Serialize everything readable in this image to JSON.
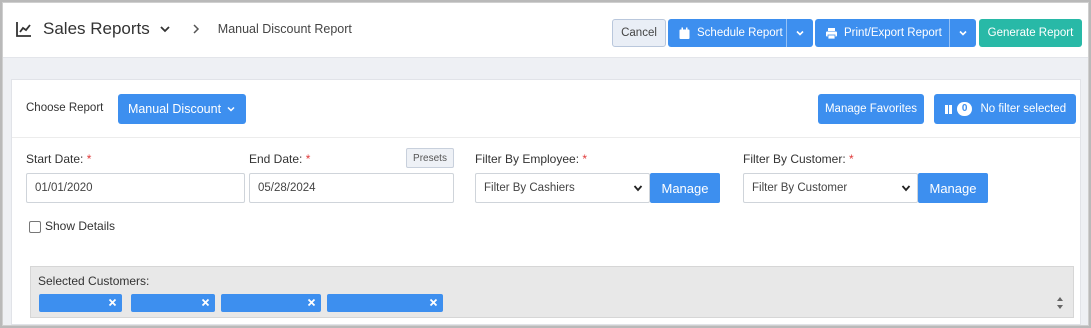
{
  "header": {
    "app_title": "Sales Reports",
    "breadcrumb": "Manual Discount Report",
    "cancel_label": "Cancel",
    "schedule_label": "Schedule Report",
    "print_label": "Print/Export Report",
    "generate_label": "Generate Report"
  },
  "report_bar": {
    "choose_label": "Choose Report",
    "selected_report": "Manual Discount",
    "favorites_label": "Manage Favorites",
    "filter_count": "0",
    "filter_label": "No filter selected"
  },
  "filters": {
    "start_date_label": "Start Date:",
    "start_date_value": "01/01/2020",
    "end_date_label": "End Date:",
    "end_date_value": "05/28/2024",
    "presets_label": "Presets",
    "employee_label": "Filter By Employee:",
    "employee_select": "Filter By Cashiers",
    "customer_label": "Filter By Customer:",
    "customer_select": "Filter By Customer",
    "manage_label": "Manage",
    "required_mark": "*",
    "show_details_label": "Show Details"
  },
  "selected_customers": {
    "title": "Selected Customers:",
    "tags": [
      "",
      "",
      "",
      ""
    ]
  },
  "colors": {
    "primary": "#3d8fef",
    "accent_green": "#28b9a7",
    "required": "#e03a3a"
  },
  "icons": [
    "chart-line-icon",
    "chevron-down-icon",
    "chevron-right-icon",
    "calendar-icon",
    "print-icon",
    "filter-icon",
    "close-icon",
    "spinner-arrows-icon"
  ]
}
